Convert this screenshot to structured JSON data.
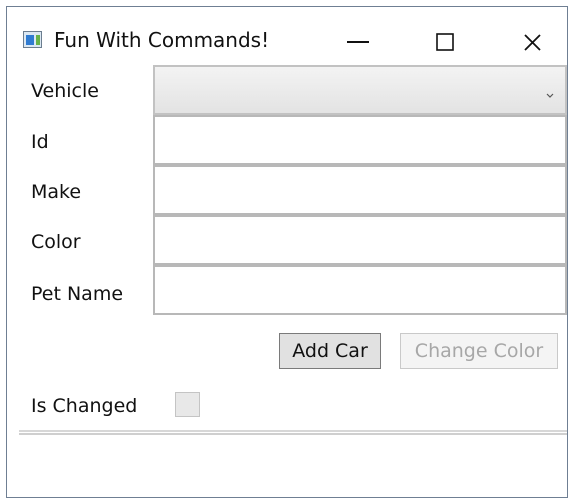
{
  "window": {
    "title": "Fun With Commands!",
    "icon": "app-window-icon",
    "controls": {
      "minimize_icon": "minimize-icon",
      "maximize_icon": "maximize-icon",
      "close_icon": "close-icon"
    }
  },
  "form": {
    "vehicle_label": "Vehicle",
    "vehicle_value": "",
    "id_label": "Id",
    "id_value": "",
    "make_label": "Make",
    "make_value": "",
    "color_label": "Color",
    "color_value": "",
    "pet_name_label": "Pet Name",
    "pet_name_value": ""
  },
  "actions": {
    "add_car_label": "Add Car",
    "change_color_label": "Change Color",
    "change_color_enabled": false
  },
  "status": {
    "is_changed_label": "Is Changed",
    "is_changed_checked": false
  },
  "colors": {
    "window_border": "#6f7f93",
    "field_border": "#b8b8b8",
    "button_background": "#e1e1e1",
    "disabled_text": "#a7a7a7"
  }
}
